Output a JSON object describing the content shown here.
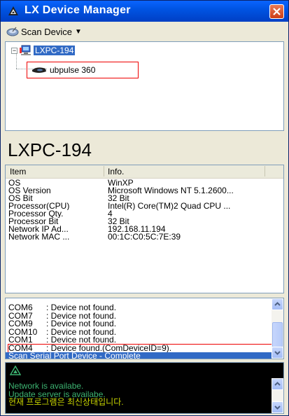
{
  "window": {
    "title": "LX Device Manager",
    "accent": "#0054e3",
    "close_color": "#cc3d15"
  },
  "toolbar": {
    "scan_label": "Scan Device",
    "scan_icon": "satellite-dish-icon"
  },
  "tree": {
    "root_label": "LXPC-194",
    "root_icon": "computer-icon",
    "child_label": "ubpulse 360",
    "child_icon": "sensor-device-icon"
  },
  "device": {
    "title": "LXPC-194"
  },
  "info": {
    "headers": [
      "Item",
      "Info."
    ],
    "rows": [
      {
        "key": "OS",
        "value": "WinXP"
      },
      {
        "key": "OS Version",
        "value": "Microsoft Windows NT 5.1.2600..."
      },
      {
        "key": "OS Bit",
        "value": "32 Bit"
      },
      {
        "key": "Processor(CPU)",
        "value": "Intel(R) Core(TM)2 Quad CPU ..."
      },
      {
        "key": "Processor Qty.",
        "value": "4"
      },
      {
        "key": "Processor Bit",
        "value": "32 Bit"
      },
      {
        "key": "Network IP Ad...",
        "value": "192.168.11.194"
      },
      {
        "key": "Network MAC ...",
        "value": "00:1C:C0:5C:7E:39"
      }
    ]
  },
  "log": {
    "lines": [
      {
        "port": "COM6",
        "msg": ": Device not found."
      },
      {
        "port": "COM7",
        "msg": ": Device not found."
      },
      {
        "port": "COM9",
        "msg": ": Device not found."
      },
      {
        "port": "COM10",
        "msg": ": Device not found."
      },
      {
        "port": "COM1",
        "msg": ": Device not found."
      },
      {
        "port": "COM4",
        "msg": ": Device found.(ComDeviceID=9)."
      }
    ],
    "status": "Scan Serial Port Device - Complete"
  },
  "network_log": {
    "icon": "lx-logo-icon",
    "lines": [
      "Network is availabe.",
      "Update server is availabe.",
      "현재 프로그램은 최신상태입니다."
    ]
  }
}
